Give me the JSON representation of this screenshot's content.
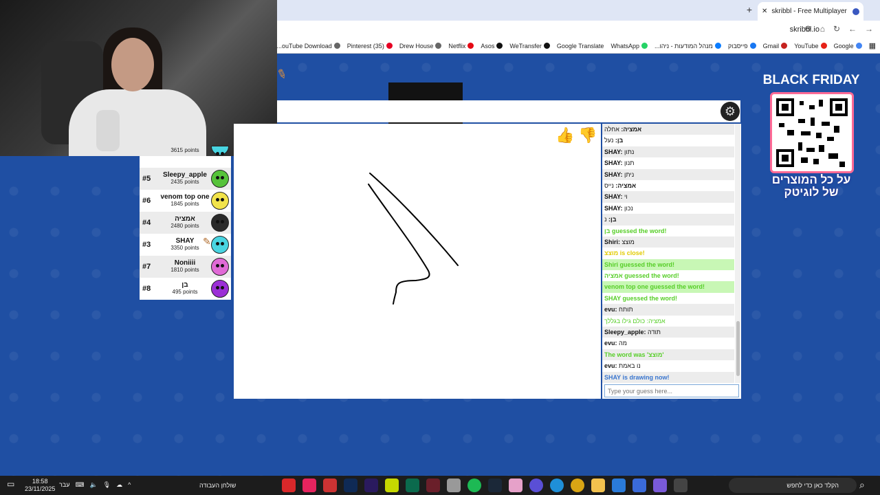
{
  "browser": {
    "tab_title": "skribbl - Free Multiplayer Draw",
    "url": "skribbl.io",
    "bookmarks": [
      "Google",
      "YouTube",
      "Gmail",
      "פייסבוק",
      "מנהל המודעות - ניהו...",
      "WhatsApp",
      "Google Translate",
      "WeTransfer",
      "Asos",
      "Netflix",
      "Drew House",
      "(35) Pinterest",
      "ouTube Download..."
    ]
  },
  "players": [
    {
      "rank": "",
      "name": "",
      "points": "3615 points",
      "color": "#49d5e2"
    },
    {
      "rank": "#5",
      "name": "Sleepy_apple",
      "points": "2435 points",
      "color": "#56c33a"
    },
    {
      "rank": "#6",
      "name": "venom top one",
      "points": "1845 points",
      "color": "#f2e34a"
    },
    {
      "rank": "#4",
      "name": "אמציה",
      "points": "2480 points",
      "color": "#2a2a2a"
    },
    {
      "rank": "#3",
      "name": "SHAY",
      "points": "3350 points",
      "color": "#49d5e2"
    },
    {
      "rank": "#7",
      "name": "Noniiii",
      "points": "1810 points",
      "color": "#e06ad6"
    },
    {
      "rank": "#8",
      "name": "בן",
      "points": "495 points",
      "color": "#9b2fd6"
    }
  ],
  "chat": {
    "messages": [
      {
        "user": "אמציה:",
        "text": " אחלה",
        "style": "alt"
      },
      {
        "user": "בן:",
        "text": " נעל",
        "style": ""
      },
      {
        "user": "SHAY:",
        "text": " נתון",
        "style": "alt"
      },
      {
        "user": "SHAY:",
        "text": " תנון",
        "style": ""
      },
      {
        "user": "SHAY:",
        "text": " ניתן",
        "style": "alt"
      },
      {
        "user": "אמציה:",
        "text": " נייס",
        "style": ""
      },
      {
        "user": "SHAY:",
        "text": " וי",
        "style": "alt"
      },
      {
        "user": "SHAY:",
        "text": " נכון",
        "style": ""
      },
      {
        "user": "בן:",
        "text": " נ",
        "style": "alt"
      },
      {
        "user": "",
        "text": "בן guessed the word!",
        "style": "green"
      },
      {
        "user": "Shiri:",
        "text": " מוצצ",
        "style": "alt"
      },
      {
        "user": "",
        "text": "מוצצ is close!",
        "style": "yellow"
      },
      {
        "user": "",
        "text": "Shiri guessed the word!",
        "style": "greenbg"
      },
      {
        "user": "",
        "text": "אמציה guessed the word!",
        "style": "green"
      },
      {
        "user": "",
        "text": "venom top one guessed the word!",
        "style": "greenbg"
      },
      {
        "user": "",
        "text": "SHAY guessed the word!",
        "style": "green"
      },
      {
        "user": "evu:",
        "text": " תותח",
        "style": "alt"
      },
      {
        "user": "",
        "text": "אמציה: כולם גילו בגללך",
        "style": "lime"
      },
      {
        "user": "Sleepy_apple:",
        "text": " תודה",
        "style": "alt"
      },
      {
        "user": "evu:",
        "text": " מה",
        "style": ""
      },
      {
        "user": "",
        "text": "The word was 'מוצצ'",
        "style": "green-alt"
      },
      {
        "user": "evu:",
        "text": " נו באמת",
        "style": ""
      },
      {
        "user": "",
        "text": "SHAY is drawing now!",
        "style": "blue-alt"
      }
    ],
    "guess_placeholder": "Type your guess here..."
  },
  "ad": {
    "title": "BLACK FRIDAY",
    "line1": "על כל המוצרים",
    "line2": "של לוגיטק"
  },
  "taskbar": {
    "time": "18:58",
    "date": "23/11/2025",
    "lang": "עבר",
    "workspace": "שולחן העבודה",
    "search_placeholder": "הקלד כאן כדי לחפש"
  },
  "colors": {
    "page_bg": "#1f4fa3",
    "guess_green": "#56ce27",
    "close_yellow": "#e2cb00",
    "drawing_blue": "#3975ce"
  },
  "icons": {
    "settings": "gear-icon",
    "like": "thumbs-up-icon",
    "dislike": "thumbs-down-icon",
    "drawing": "pencil-icon"
  }
}
